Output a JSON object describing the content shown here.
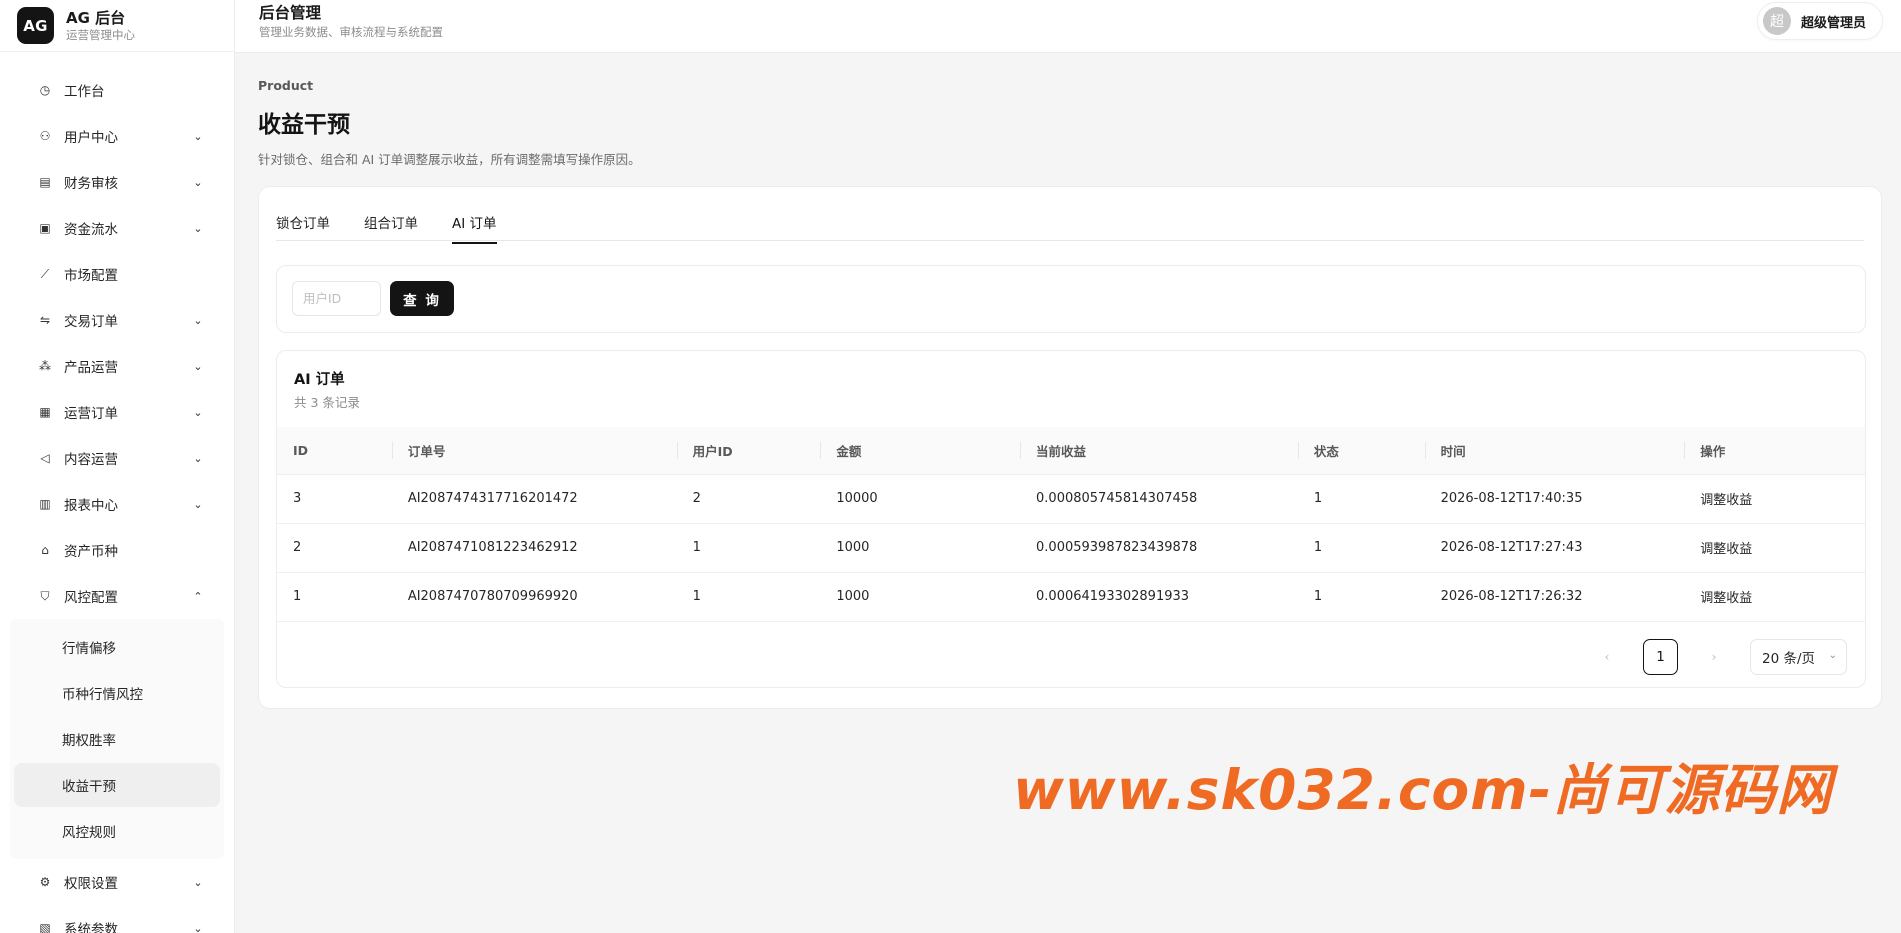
{
  "brand": {
    "logo": "AG",
    "title": "AG 后台",
    "subtitle": "运营管理中心"
  },
  "header": {
    "title": "后台管理",
    "subtitle": "管理业务数据、审核流程与系统配置"
  },
  "user": {
    "avatar": "超",
    "name": "超级管理员"
  },
  "sidebar": {
    "items": [
      {
        "label": "工作台",
        "icon": "dashboard-icon",
        "glyph": "◷",
        "chevron": ""
      },
      {
        "label": "用户中心",
        "icon": "user-icon",
        "glyph": "⚇",
        "chevron": "⌄"
      },
      {
        "label": "财务审核",
        "icon": "audit-icon",
        "glyph": "▤",
        "chevron": "⌄"
      },
      {
        "label": "资金流水",
        "icon": "wallet-icon",
        "glyph": "▣",
        "chevron": "⌄"
      },
      {
        "label": "市场配置",
        "icon": "trend-icon",
        "glyph": "⟋",
        "chevron": ""
      },
      {
        "label": "交易订单",
        "icon": "swap-icon",
        "glyph": "⇋",
        "chevron": "⌄"
      },
      {
        "label": "产品运营",
        "icon": "cluster-icon",
        "glyph": "⁂",
        "chevron": "⌄"
      },
      {
        "label": "运营订单",
        "icon": "calendar-icon",
        "glyph": "▦",
        "chevron": "⌄"
      },
      {
        "label": "内容运营",
        "icon": "megaphone-icon",
        "glyph": "◁",
        "chevron": "⌄"
      },
      {
        "label": "报表中心",
        "icon": "bar-chart-icon",
        "glyph": "▥",
        "chevron": "⌄"
      },
      {
        "label": "资产币种",
        "icon": "bank-icon",
        "glyph": "⌂",
        "chevron": ""
      },
      {
        "label": "风控配置",
        "icon": "shield-icon",
        "glyph": "⛉",
        "chevron": "⌃"
      }
    ],
    "risk_submenu": [
      "行情偏移",
      "币种行情风控",
      "期权胜率",
      "收益干预",
      "风控规则"
    ],
    "bottom_items": [
      {
        "label": "权限设置",
        "icon": "gear-icon",
        "glyph": "⚙",
        "chevron": "⌄"
      },
      {
        "label": "系统参数",
        "icon": "settings-doc-icon",
        "glyph": "▧",
        "chevron": "⌄"
      }
    ]
  },
  "page": {
    "eyebrow": "Product",
    "title": "收益干预",
    "description": "针对锁仓、组合和 AI 订单调整展示收益，所有调整需填写操作原因。"
  },
  "tabs": [
    "锁仓订单",
    "组合订单",
    "AI 订单"
  ],
  "filter": {
    "placeholder": "用户ID",
    "query_label": "查 询"
  },
  "table": {
    "title": "AI 订单",
    "count": "共 3 条记录",
    "columns": [
      "ID",
      "订单号",
      "用户ID",
      "金额",
      "当前收益",
      "状态",
      "时间",
      "操作"
    ],
    "rows": [
      [
        "3",
        "AI2087474317716201472",
        "2",
        "10000",
        "0.000805745814307458",
        "1",
        "2026-08-12T17:40:35",
        "调整收益"
      ],
      [
        "2",
        "AI2087471081223462912",
        "1",
        "1000",
        "0.000593987823439878",
        "1",
        "2026-08-12T17:27:43",
        "调整收益"
      ],
      [
        "1",
        "AI2087470780709969920",
        "1",
        "1000",
        "0.00064193302891933",
        "1",
        "2026-08-12T17:26:32",
        "调整收益"
      ]
    ]
  },
  "pagination": {
    "current": "1",
    "page_size": "20 条/页",
    "prev": "‹",
    "next": "›"
  },
  "watermark": "www.sk032.com-尚可源码网",
  "colors": {
    "primary": "#141414",
    "watermark": "#ef6a23",
    "background": "#f5f5f5"
  }
}
